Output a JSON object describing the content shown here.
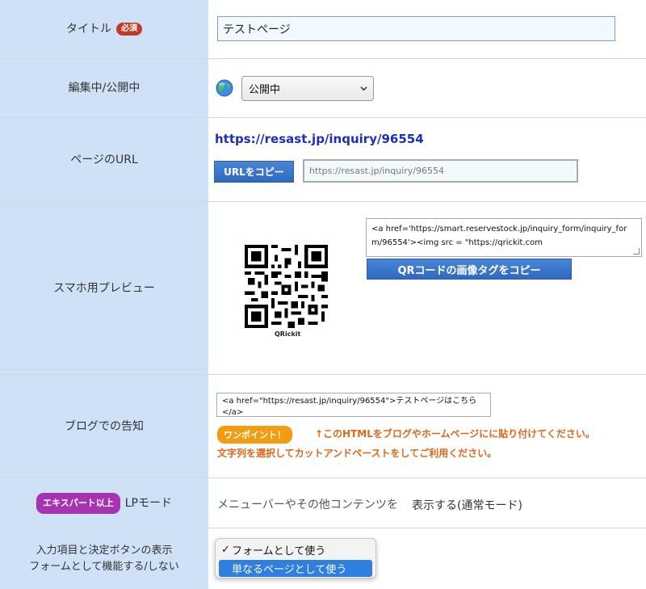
{
  "title_row": {
    "label": "タイトル",
    "required_badge": "必須",
    "value": "テストページ"
  },
  "status_row": {
    "label": "編集中/公開中",
    "selected": "公開中",
    "icon": "globe-icon"
  },
  "url_row": {
    "label": "ページのURL",
    "url": "https://resast.jp/inquiry/96554",
    "copy_button": "URLをコピー",
    "input_value": "https://resast.jp/inquiry/96554"
  },
  "preview_row": {
    "label": "スマホ用プレビュー",
    "qr_caption": "QRickit",
    "tag_text": "<a href='https://smart.reservestock.jp/inquiry_form/inquiry_form/96554'><img src = \"https://qrickit.com",
    "copy_button": "QRコードの画像タグをコピー"
  },
  "blog_row": {
    "label": "ブログでの告知",
    "tag_text": "<a href=\"https://resast.jp/inquiry/96554\">テストページはこちら</a>",
    "tip_badge": "ワンポイント！",
    "tip_line1": "↑このHTMLをブログやホームページにに貼り付けてください。",
    "tip_line2": "文字列を選択してカットアンドペーストをしてご利用ください。"
  },
  "lp_row": {
    "badge": "エキスパート以上",
    "label": "LPモード",
    "text": "メニューバーやその他コンテンツを",
    "mode": "表示する(通常モード)"
  },
  "form_row": {
    "label_line1": "入力項目と決定ボタンの表示",
    "label_line2": "フォームとして機能する/しない",
    "options": [
      "フォームとして使う",
      "単なるページとして使う"
    ],
    "checkmark": "✓"
  },
  "colors": {
    "label_bg": "#cfe1f7",
    "link": "#1c2fbf",
    "accent_orange": "#e0661a",
    "badge_purple": "#a733b3",
    "badge_red": "#c0392b"
  }
}
